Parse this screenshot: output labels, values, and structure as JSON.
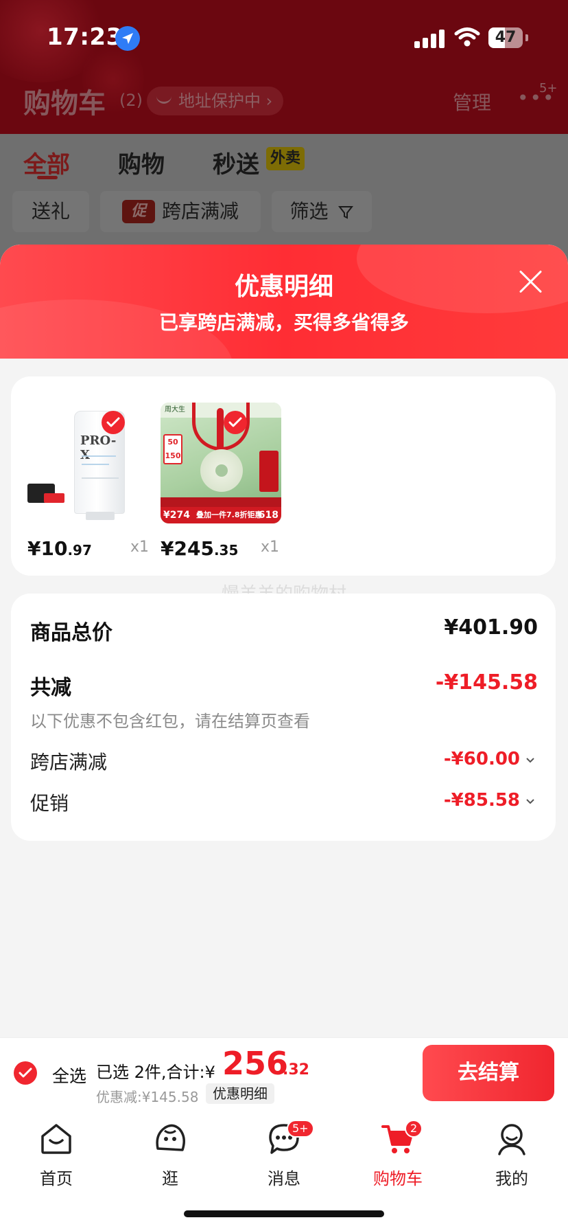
{
  "status_bar": {
    "time": "17:23",
    "battery": "47"
  },
  "header": {
    "title": "购物车",
    "count": "(2)",
    "address_pill": "地址保护中",
    "manage": "管理",
    "more_badge": "5+"
  },
  "tabs": [
    {
      "label": "全部",
      "active": true
    },
    {
      "label": "购物",
      "active": false
    },
    {
      "label": "秒送",
      "active": false
    }
  ],
  "tab_tag": "外卖",
  "filters": {
    "gift": "送礼",
    "promo_mark": "促",
    "cross_store": "跨店满减",
    "filter": "筛选"
  },
  "sheet": {
    "title": "优惠明细",
    "subtitle": "已享跨店满减，买得多省得多"
  },
  "products": [
    {
      "brand": "PRO-X",
      "price_int": "¥10",
      "price_dec": ".97",
      "qty": "x1"
    },
    {
      "price_int": "¥245",
      "price_dec": ".35",
      "qty": "x1"
    }
  ],
  "product2_labels": {
    "shop": "周大生",
    "coupon_50": "50",
    "coupon_150": "150",
    "price_left": "¥274",
    "promo_mid": "叠加一件7.8折钜惠",
    "price_right": "618"
  },
  "watermark": "慢羊羊的购物村",
  "summary": {
    "total_label": "商品总价",
    "total_value": "¥401.90",
    "reduce_label": "共减",
    "reduce_value": "-¥145.58",
    "note": "以下优惠不包含红包，请在结算页查看",
    "items": [
      {
        "label": "跨店满减",
        "value": "-¥60.00"
      },
      {
        "label": "促销",
        "value": "-¥85.58"
      }
    ]
  },
  "checkout": {
    "select_all": "全选",
    "selected_text": "已选 2件,合计:¥",
    "total_int": "256",
    "total_dec": ".32",
    "discount": "优惠减:¥145.58",
    "detail_chip": "优惠明细",
    "button": "去结算"
  },
  "tabbar": [
    {
      "label": "首页",
      "icon": "home-icon"
    },
    {
      "label": "逛",
      "icon": "face-icon"
    },
    {
      "label": "消息",
      "icon": "message-icon",
      "badge": "5+"
    },
    {
      "label": "购物车",
      "icon": "cart-icon",
      "badge": "2",
      "active": true
    },
    {
      "label": "我的",
      "icon": "profile-icon"
    }
  ],
  "colors": {
    "accent": "#f0262f",
    "price_red": "#ee1d27"
  }
}
